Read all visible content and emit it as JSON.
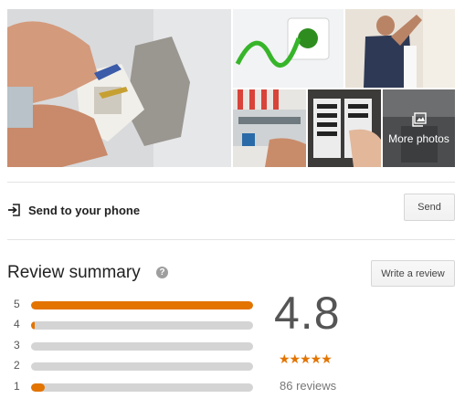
{
  "photos": {
    "more_photos_label": "More photos"
  },
  "send": {
    "label": "Send to your phone",
    "button_label": "Send"
  },
  "reviews": {
    "title": "Review summary",
    "help_glyph": "?",
    "write_button_label": "Write a review",
    "rating": "4.8",
    "stars": "★★★★★",
    "count_label": "86 reviews",
    "accent_color": "#e37400",
    "distribution": [
      {
        "label": "5",
        "fraction": 1.0
      },
      {
        "label": "4",
        "fraction": 0.015
      },
      {
        "label": "3",
        "fraction": 0.0
      },
      {
        "label": "2",
        "fraction": 0.0
      },
      {
        "label": "1",
        "fraction": 0.06
      }
    ]
  }
}
